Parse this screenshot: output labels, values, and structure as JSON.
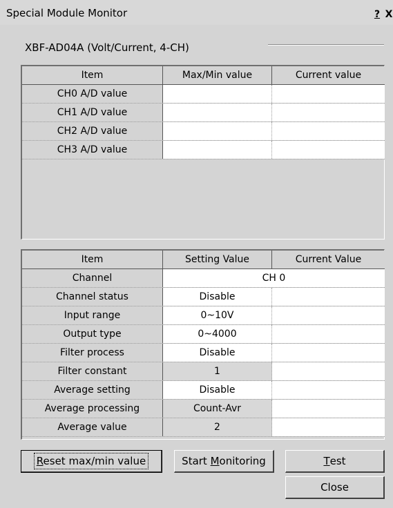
{
  "window": {
    "title": "Special Module Monitor",
    "help_label": "?",
    "close_label": "X"
  },
  "module": {
    "label": "XBF-AD04A (Volt/Current, 4-CH)"
  },
  "monitor_table": {
    "headers": [
      "Item",
      "Max/Min value",
      "Current value"
    ],
    "rows": [
      {
        "item": "CH0 A/D value",
        "maxmin": "",
        "current": ""
      },
      {
        "item": "CH1 A/D value",
        "maxmin": "",
        "current": ""
      },
      {
        "item": "CH2 A/D value",
        "maxmin": "",
        "current": ""
      },
      {
        "item": "CH3 A/D value",
        "maxmin": "",
        "current": ""
      }
    ]
  },
  "settings_table": {
    "headers": [
      "Item",
      "Setting Value",
      "Current Value"
    ],
    "channel_label": "Channel",
    "channel_value": "CH 0",
    "rows": [
      {
        "item": "Channel status",
        "setting": "Disable",
        "current": ""
      },
      {
        "item": "Input range",
        "setting": "0~10V",
        "current": ""
      },
      {
        "item": "Output type",
        "setting": "0~4000",
        "current": ""
      },
      {
        "item": "Filter process",
        "setting": "Disable",
        "current": ""
      },
      {
        "item": "Filter constant",
        "setting": "1",
        "current": ""
      },
      {
        "item": "Average setting",
        "setting": "Disable",
        "current": ""
      },
      {
        "item": "Average processing",
        "setting": "Count-Avr",
        "current": ""
      },
      {
        "item": "Average value",
        "setting": "2",
        "current": ""
      }
    ]
  },
  "buttons": {
    "reset": {
      "accel": "R",
      "rest": "eset max/min value"
    },
    "start": {
      "pre": "Start ",
      "accel": "M",
      "rest": "onitoring"
    },
    "test": {
      "accel": "T",
      "rest": "est"
    },
    "close": "Close"
  }
}
